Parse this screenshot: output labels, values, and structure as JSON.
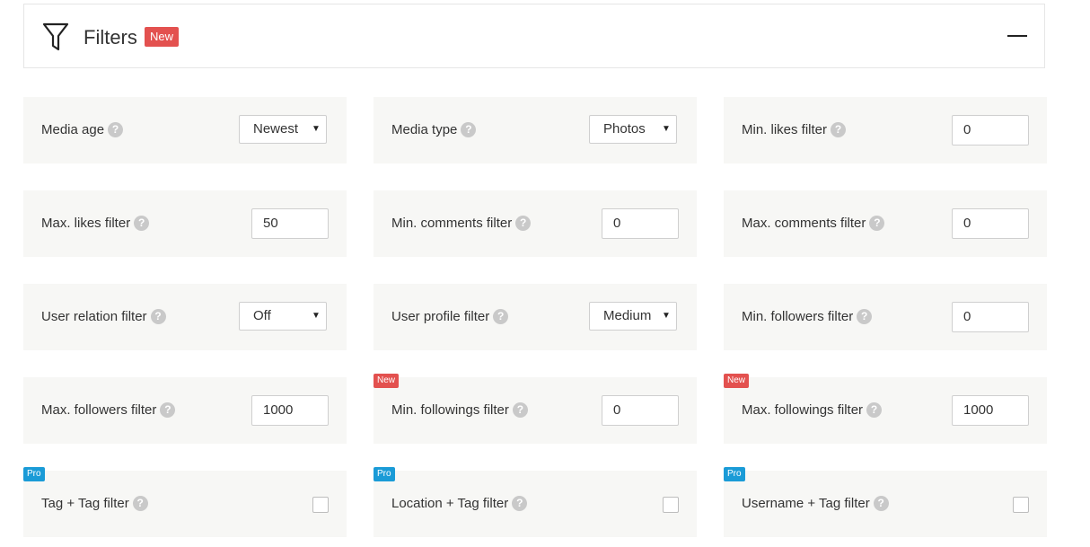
{
  "header": {
    "title": "Filters",
    "badge": "New"
  },
  "filters": {
    "media_age": {
      "label": "Media age",
      "value": "Newest"
    },
    "media_type": {
      "label": "Media type",
      "value": "Photos"
    },
    "min_likes": {
      "label": "Min. likes filter",
      "value": "0"
    },
    "max_likes": {
      "label": "Max. likes filter",
      "value": "50"
    },
    "min_comments": {
      "label": "Min. comments filter",
      "value": "0"
    },
    "max_comments": {
      "label": "Max. comments filter",
      "value": "0"
    },
    "user_relation": {
      "label": "User relation filter",
      "value": "Off"
    },
    "user_profile": {
      "label": "User profile filter",
      "value": "Medium"
    },
    "min_followers": {
      "label": "Min. followers filter",
      "value": "0"
    },
    "max_followers": {
      "label": "Max. followers filter",
      "value": "1000"
    },
    "min_followings": {
      "label": "Min. followings filter",
      "value": "0",
      "badge": "New"
    },
    "max_followings": {
      "label": "Max. followings filter",
      "value": "1000",
      "badge": "New"
    },
    "tag_tag": {
      "label": "Tag + Tag filter",
      "badge": "Pro",
      "checked": false
    },
    "location_tag": {
      "label": "Location + Tag filter",
      "badge": "Pro",
      "checked": false
    },
    "username_tag": {
      "label": "Username + Tag filter",
      "badge": "Pro",
      "checked": false
    }
  },
  "help_glyph": "?",
  "caret_glyph": "▼",
  "colors": {
    "new_badge": "#e3514f",
    "pro_badge": "#1a9bd7",
    "card_bg": "#f7f7f5"
  }
}
